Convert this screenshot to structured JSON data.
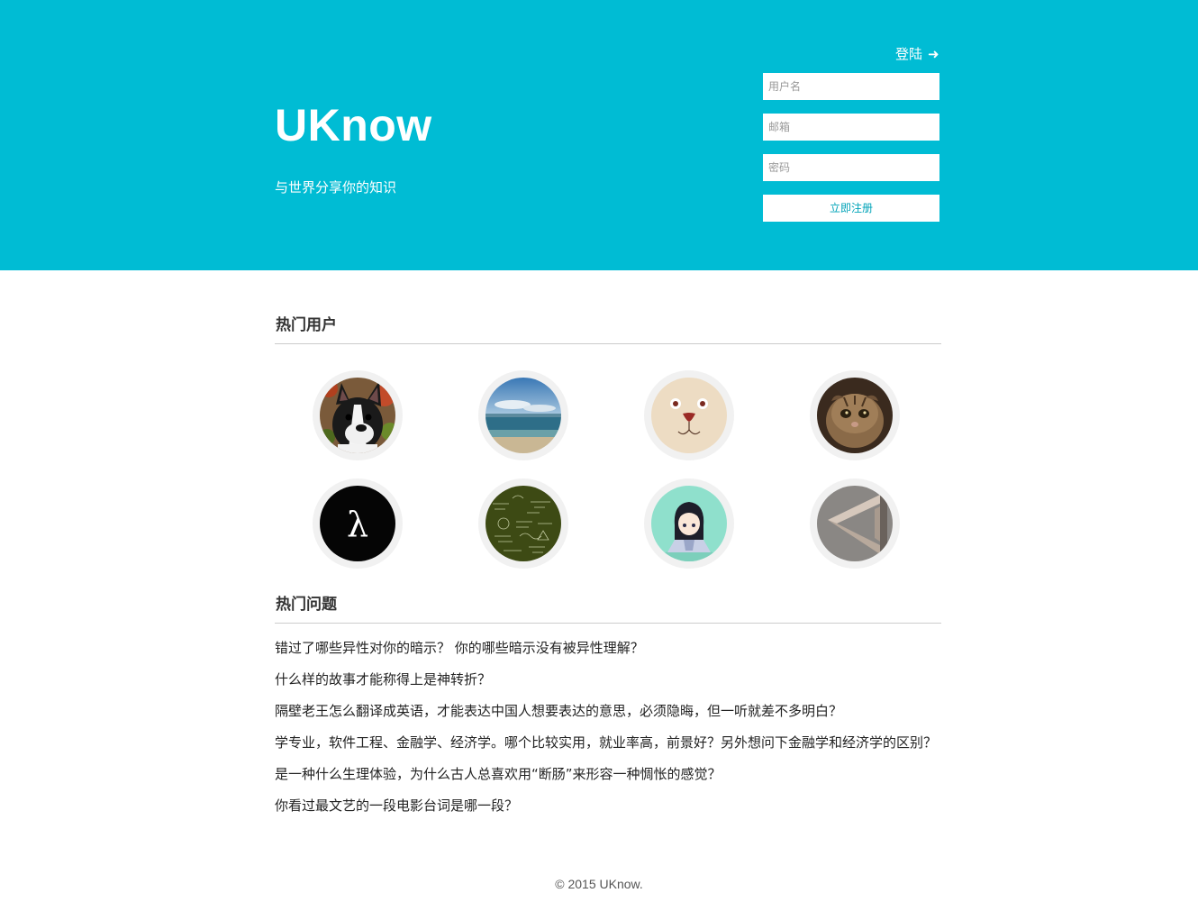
{
  "header": {
    "title": "UKnow",
    "tagline": "与世界分享你的知识",
    "login_label": "登陆",
    "login_arrow": "➜",
    "background_color": "#00bcd4"
  },
  "register_form": {
    "username_placeholder": "用户名",
    "email_placeholder": "邮箱",
    "password_placeholder": "密码",
    "submit_label": "立即注册"
  },
  "hot_users": {
    "title": "热门用户",
    "avatars": [
      {
        "icon": "boston-terrier-avatar-icon"
      },
      {
        "icon": "beach-seascape-avatar-icon"
      },
      {
        "icon": "cartoon-bear-face-avatar-icon"
      },
      {
        "icon": "scottish-fold-cat-avatar-icon"
      },
      {
        "icon": "lambda-avatar-icon",
        "text": "λ"
      },
      {
        "icon": "chalkboard-formulas-avatar-icon"
      },
      {
        "icon": "anime-girl-avatar-icon"
      },
      {
        "icon": "penrose-triangle-avatar-icon"
      }
    ]
  },
  "hot_questions": {
    "title": "热门问题",
    "items": [
      "错过了哪些异性对你的暗示？ 你的哪些暗示没有被异性理解？",
      "什么样的故事才能称得上是神转折？",
      "隔壁老王怎么翻译成英语，才能表达中国人想要表达的意思，必须隐晦，但一听就差不多明白？",
      "学专业，软件工程、金融学、经济学。哪个比较实用，就业率高，前景好？另外想问下金融学和经济学的区别？",
      "是一种什么生理体验，为什么古人总喜欢用“断肠”来形容一种惆怅的感觉？",
      "你看过最文艺的一段电影台词是哪一段？"
    ]
  },
  "footer": {
    "copyright": "© 2015 UKnow."
  }
}
